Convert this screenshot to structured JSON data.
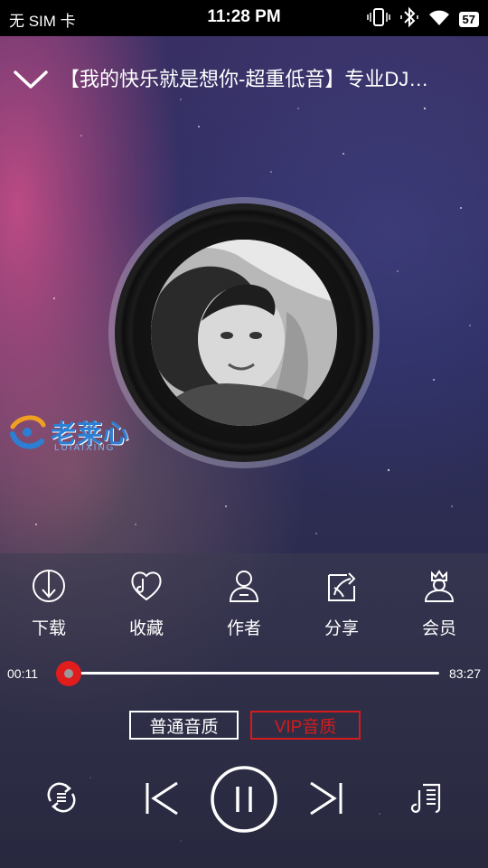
{
  "status_bar": {
    "carrier": "无 SIM 卡",
    "time": "11:28 PM",
    "battery": "57"
  },
  "header": {
    "title": "【我的快乐就是想你-超重低音】专业DJ…"
  },
  "watermark": {
    "name_cn": "老莱心",
    "name_en": "LUIAIXING"
  },
  "actions": [
    {
      "label": "下载",
      "icon": "download-icon"
    },
    {
      "label": "收藏",
      "icon": "favorite-icon"
    },
    {
      "label": "作者",
      "icon": "author-icon"
    },
    {
      "label": "分享",
      "icon": "share-icon"
    },
    {
      "label": "会员",
      "icon": "member-icon"
    }
  ],
  "player": {
    "current_time": "00:11",
    "duration": "83:27",
    "progress": 0.002
  },
  "quality": {
    "normal": "普通音质",
    "vip": "VIP音质"
  },
  "colors": {
    "accent": "#e01c1c",
    "vip": "#d41c1c",
    "watermark": "#2b7fd4"
  },
  "transport": {
    "repeat": "repeat-icon",
    "previous": "previous-icon",
    "play_pause": "pause-icon",
    "next": "next-icon",
    "playlist": "playlist-icon"
  }
}
